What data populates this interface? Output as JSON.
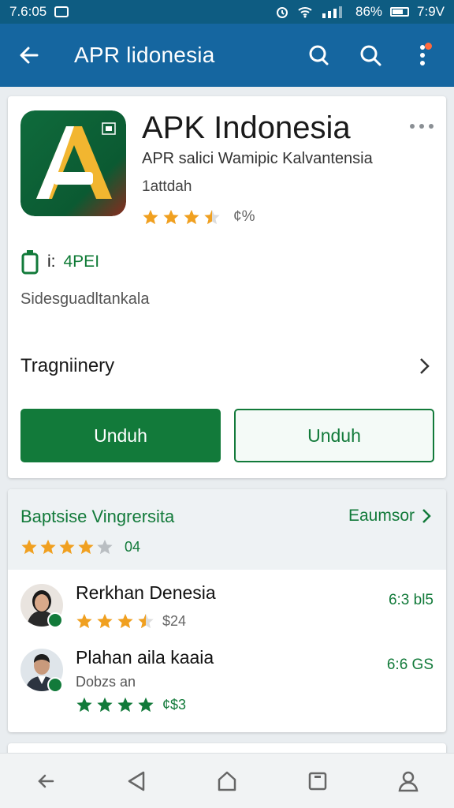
{
  "status_bar": {
    "time": "7.6:05",
    "battery": "86%",
    "clock2": "7:9V"
  },
  "app_bar": {
    "title": "APR lidonesia"
  },
  "app": {
    "name": "APK Indonesia",
    "description": "APR salici Wamipic Kalvantensia",
    "developer": "1attdah",
    "rating_stars": 3.5,
    "rating_extra": "¢%",
    "info_label": "i:",
    "info_value": "4PEI",
    "sub_text": "Sidesguadltankala",
    "section_title": "Tragniinery",
    "primary_button": "Unduh",
    "secondary_button": "Unduh"
  },
  "reviews": {
    "title": "Baptsise Vingrersita",
    "link": "Eaumsor",
    "rating_stars": 4,
    "count": "04",
    "items": [
      {
        "name": "Rerkhan Denesia",
        "stars": 3.5,
        "meta": "$24",
        "date": "6:3 bl5"
      },
      {
        "name": "Plahan aila kaaia",
        "sub": "Dobzs an",
        "stars": 4,
        "meta": "¢$3",
        "date": "6:6 GS"
      }
    ]
  },
  "colors": {
    "app_bar": "#1566a0",
    "status_bar": "#0e5c82",
    "accent_green": "#127a3a",
    "star": "#f0a020"
  }
}
